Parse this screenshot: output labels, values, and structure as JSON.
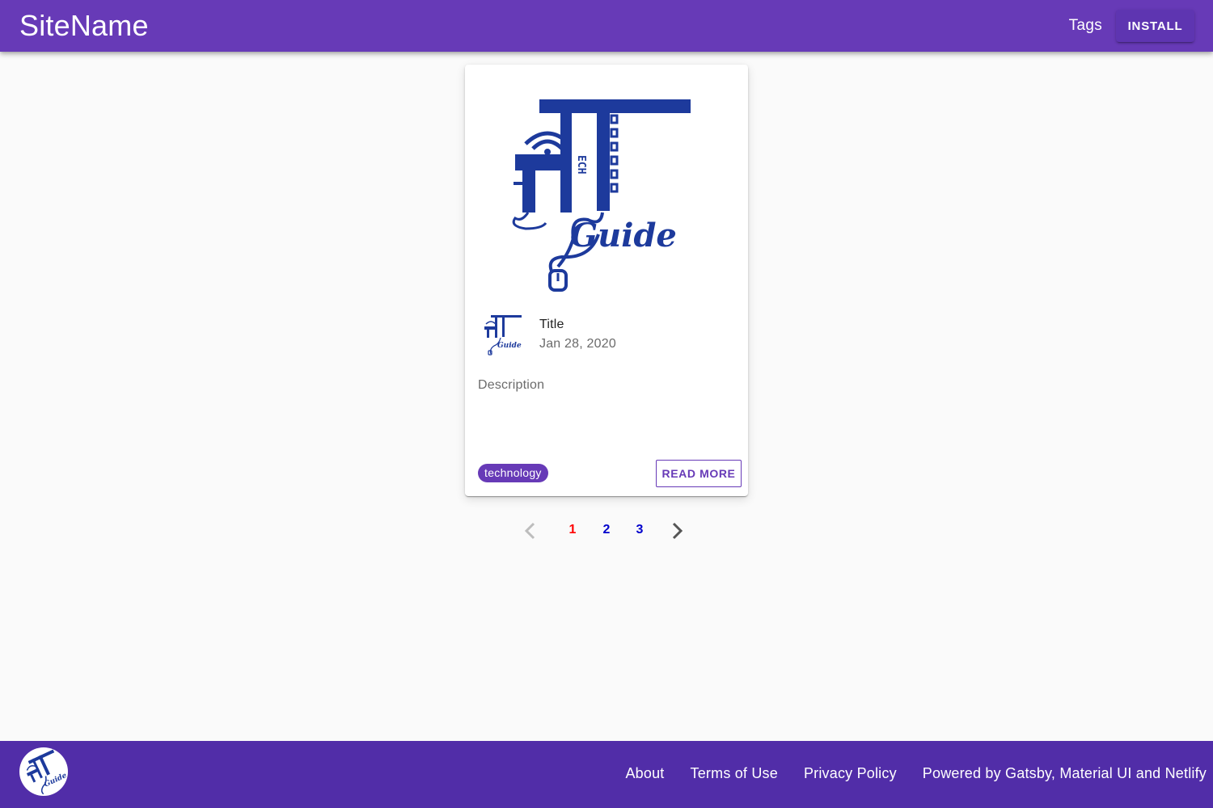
{
  "header": {
    "site_name": "SiteName",
    "tags_label": "Tags",
    "install_label": "INSTALL",
    "color": "#673ab7"
  },
  "card": {
    "image_icon": "tech-guide-logo",
    "avatar_icon": "tech-guide-logo",
    "logo_text": "Guide",
    "logo_letters": "ECH",
    "title": "Title",
    "date": "Jan 28, 2020",
    "description": "Description",
    "tag": "technology",
    "read_more_label": "READ MORE"
  },
  "pagination": {
    "prev_icon": "chevron-left-icon",
    "next_icon": "chevron-right-icon",
    "pages": [
      "1",
      "2",
      "3"
    ],
    "current": "1",
    "current_color": "#ff0000",
    "page_color": "#0000cc"
  },
  "footer": {
    "logo_icon": "tech-guide-logo",
    "links": [
      "About",
      "Terms of Use",
      "Privacy Policy",
      "Powered by Gatsby, Material UI and Netlify"
    ],
    "color": "#512da8"
  }
}
